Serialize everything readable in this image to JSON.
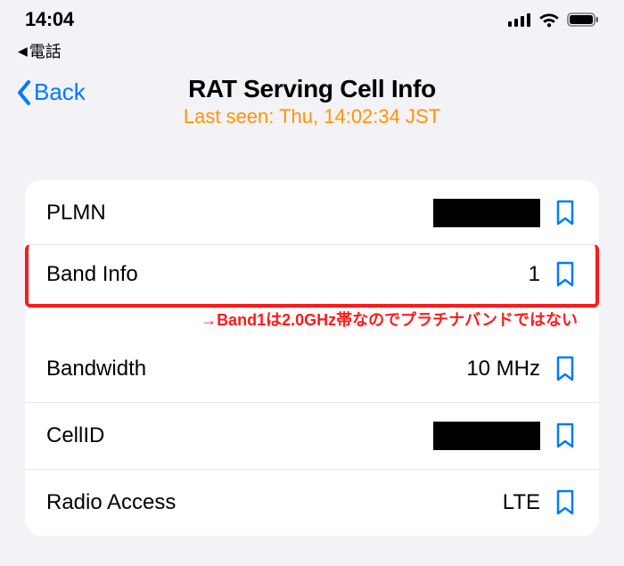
{
  "status_bar": {
    "time": "14:04",
    "signal_bars": 4,
    "wifi_on": true,
    "battery_pct": 90
  },
  "breadcrumb": {
    "app_label": "電話"
  },
  "nav": {
    "back_label": "Back",
    "title": "RAT Serving Cell Info",
    "subtitle": "Last seen: Thu, 14:02:34 JST"
  },
  "rows": [
    {
      "label": "PLMN",
      "value": "",
      "redacted": true
    },
    {
      "label": "Band Info",
      "value": "1",
      "highlighted": true
    },
    {
      "label": "Bandwidth",
      "value": "10 MHz"
    },
    {
      "label": "CellID",
      "value": "",
      "redacted": true
    },
    {
      "label": "Radio Access",
      "value": "LTE"
    }
  ],
  "annotation": "→Band1は2.0GHz帯なのでプラチナバンドではない",
  "colors": {
    "accent_orange": "#ff9500",
    "ios_blue": "#007aff",
    "highlight_red": "#ff1a1a"
  }
}
